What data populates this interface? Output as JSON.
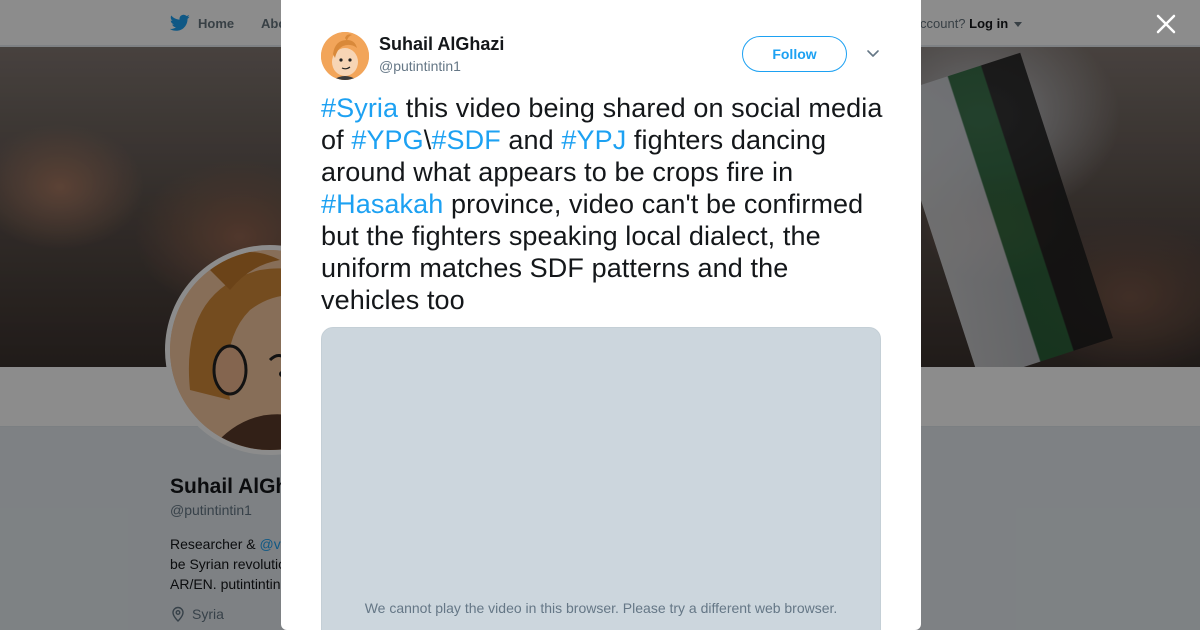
{
  "nav": {
    "home_label": "Home",
    "about_label": "Abo",
    "account_prompt": "ccount?",
    "login_label": "Log in"
  },
  "profile": {
    "name": "Suhail AlGh",
    "handle": "@putintintin1",
    "bio_prefix": "Researcher & ",
    "bio_link": "@v",
    "bio_line2": "be Syrian revolutio",
    "bio_line3": "AR/EN. putintintin",
    "location": "Syria"
  },
  "tweet": {
    "author_name": "Suhail AlGhazi",
    "author_handle": "@putintintin1",
    "follow_label": "Follow",
    "text": {
      "tag_syria": "#Syria",
      "t1": " this video being shared on social media of ",
      "tag_ypg": "#YPG",
      "sep": "\\",
      "tag_sdf": "#SDF",
      "t2": " and ",
      "tag_ypj": "#YPJ",
      "t3": " fighters dancing around what appears to be crops fire in ",
      "tag_hasakah": "#Hasakah",
      "t4": " province, video can't be confirmed but the fighters speaking local dialect, the uniform matches SDF patterns and the vehicles too"
    },
    "media_message": "We cannot play the video in this browser. Please try a different web browser."
  },
  "colors": {
    "twitter_blue": "#1da1f2",
    "media_bg": "#ccd6dd",
    "overlay": "rgba(0,0,0,0.45)"
  },
  "icons": [
    "twitter-bird-icon",
    "caret-down-icon",
    "location-pin-icon",
    "close-icon",
    "chevron-down-icon"
  ]
}
